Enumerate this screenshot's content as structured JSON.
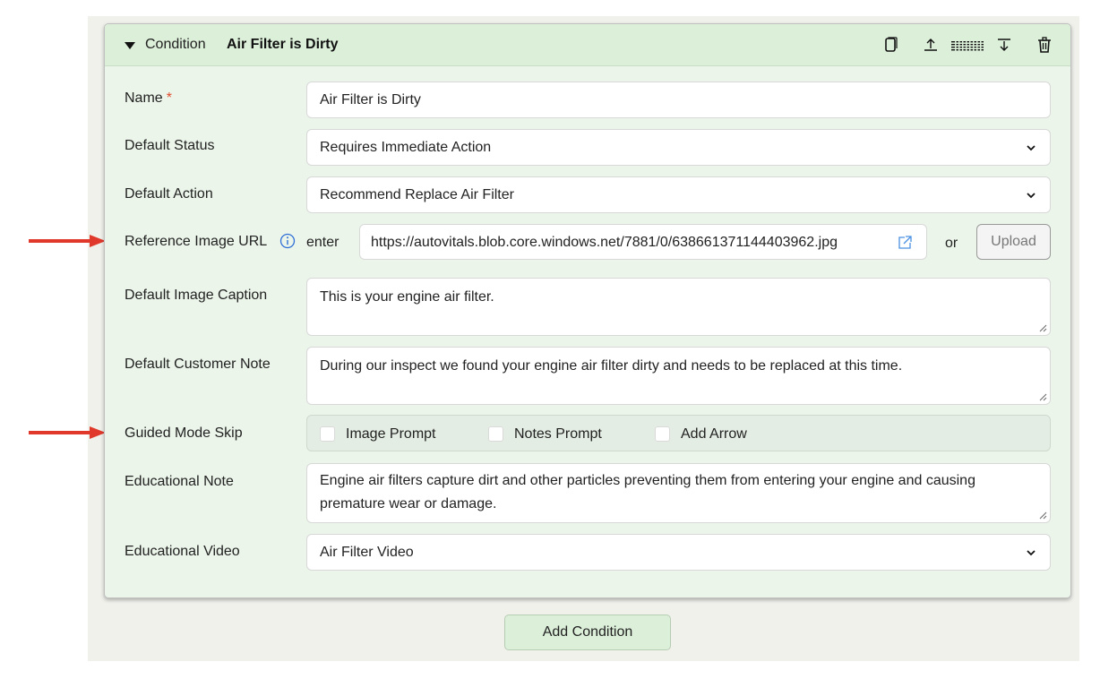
{
  "header": {
    "section_label": "Condition",
    "title": "Air Filter is Dirty",
    "icons": [
      "copy-icon",
      "move-up-icon",
      "drag-handle-icon",
      "move-down-icon",
      "trash-icon"
    ]
  },
  "form": {
    "name": {
      "label": "Name",
      "required_marker": "*",
      "value": "Air Filter is Dirty"
    },
    "default_status": {
      "label": "Default Status",
      "value": "Requires Immediate Action"
    },
    "default_action": {
      "label": "Default Action",
      "value": "Recommend Replace Air Filter"
    },
    "reference_image": {
      "label": "Reference Image URL",
      "enter_label": "enter",
      "value": "https://autovitals.blob.core.windows.net/7881/0/638661371144403962.jpg",
      "or_label": "or",
      "upload_label": "Upload"
    },
    "default_image_caption": {
      "label": "Default Image Caption",
      "value": "This is your engine air filter."
    },
    "default_customer_note": {
      "label": "Default Customer Note",
      "value": "During our inspect we found your engine air filter dirty and needs to be replaced at this time."
    },
    "guided_mode_skip": {
      "label": "Guided Mode Skip",
      "options": [
        {
          "label": "Image Prompt",
          "checked": false
        },
        {
          "label": "Notes Prompt",
          "checked": false
        },
        {
          "label": "Add Arrow",
          "checked": false
        }
      ]
    },
    "educational_note": {
      "label": "Educational Note",
      "value": "Engine air filters capture dirt and other particles preventing them from entering your engine and causing premature wear or damage."
    },
    "educational_video": {
      "label": "Educational Video",
      "value": "Air Filter Video"
    }
  },
  "footer": {
    "add_condition_label": "Add Condition"
  },
  "colors": {
    "card_bg": "#ebf5ea",
    "header_bg": "#dcefd9",
    "required": "#e24a2e",
    "info_icon": "#2f6fd6",
    "arrow": "#e0392b"
  }
}
